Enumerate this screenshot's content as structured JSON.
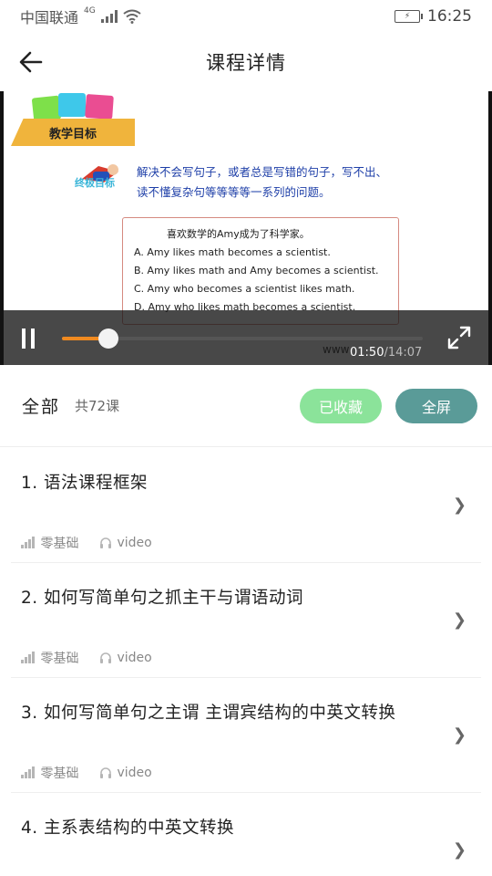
{
  "status_bar": {
    "carrier": "中国联通",
    "network": "4G",
    "time": "16:25"
  },
  "header": {
    "title": "课程详情"
  },
  "video": {
    "slide": {
      "banner": "教学目标",
      "hero_label": "终极目标",
      "line1": "解决不会写句子，或者总是写错的句子，写不出、",
      "line2": "读不懂复杂句等等等等一系列的问题。",
      "question_title": "喜欢数学的Amy成为了科学家。",
      "options": [
        "A.  Amy likes math becomes a scientist.",
        "B.  Amy likes math and Amy becomes a scientist.",
        "C.  Amy who becomes a scientist likes math.",
        "D.  Amy who likes math becomes a scientist."
      ],
      "url_peek": "www"
    },
    "current_time": "01:50",
    "separator": "/",
    "total_time": "14:07",
    "progress": 0.13
  },
  "summary": {
    "all_label": "全部",
    "count_label": "共72课",
    "favorite_label": "已收藏",
    "fullscreen_label": "全屏"
  },
  "courses": [
    {
      "title": "1. 语法课程框架",
      "level": "零基础",
      "type": "video"
    },
    {
      "title": "2. 如何写简单句之抓主干与谓语动词",
      "level": "零基础",
      "type": "video"
    },
    {
      "title": "3. 如何写简单句之主谓 主谓宾结构的中英文转换",
      "level": "零基础",
      "type": "video"
    },
    {
      "title": "4. 主系表结构的中英文转换",
      "level": "",
      "type": ""
    }
  ],
  "colors": {
    "favorite_bg": "#8be39a",
    "fullscreen_bg": "#5a9b98",
    "progress": "#f08a20"
  }
}
